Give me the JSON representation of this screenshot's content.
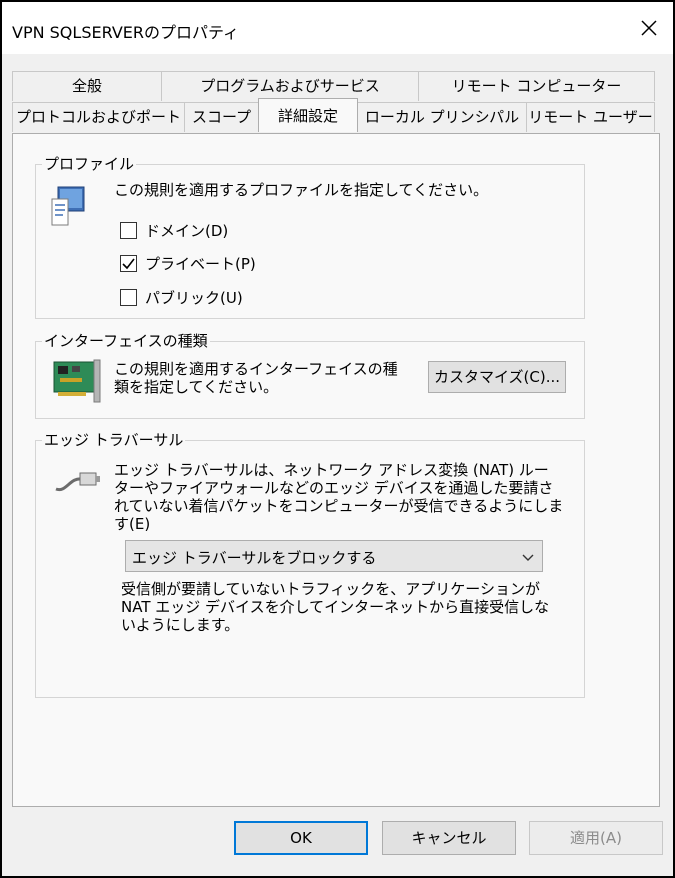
{
  "window": {
    "title": "VPN SQLSERVERのプロパティ"
  },
  "tabs": {
    "row1": [
      {
        "label": "全般"
      },
      {
        "label": "プログラムおよびサービス"
      },
      {
        "label": "リモート コンピューター"
      }
    ],
    "row2": [
      {
        "label": "プロトコルおよびポート"
      },
      {
        "label": "スコープ"
      },
      {
        "label": "詳細設定",
        "active": true
      },
      {
        "label": "ローカル プリンシパル"
      },
      {
        "label": "リモート ユーザー"
      }
    ]
  },
  "profile": {
    "group_label": "プロファイル",
    "description": "この規則を適用するプロファイルを指定してください。",
    "options": [
      {
        "label": "ドメイン(D)",
        "checked": false
      },
      {
        "label": "プライベート(P)",
        "checked": true
      },
      {
        "label": "パブリック(U)",
        "checked": false
      }
    ]
  },
  "interface": {
    "group_label": "インターフェイスの種類",
    "description_line1": "この規則を適用するインターフェイスの種",
    "description_line2": "類を指定してください。",
    "customize_label": "カスタマイズ(C)..."
  },
  "edge": {
    "group_label": "エッジ トラバーサル",
    "description_line1": "エッジ トラバーサルは、ネットワーク アドレス変換 (NAT) ルー",
    "description_line2": "ターやファイアウォールなどのエッジ デバイスを通過した要請さ",
    "description_line3": "れていない着信パケットをコンピューターが受信できるようにしま",
    "description_line4": "す(E)",
    "select_value": "エッジ トラバーサルをブロックする",
    "hint_line1": "受信側が要請していないトラフィックを、アプリケーションが",
    "hint_line2": "NAT エッジ デバイスを介してインターネットから直接受信しな",
    "hint_line3": "いようにします。"
  },
  "buttons": {
    "ok": "OK",
    "cancel": "キャンセル",
    "apply": "適用(A)"
  },
  "icons": {
    "close": "close-icon",
    "profile": "computer-icon",
    "interface": "network-card-icon",
    "edge": "cable-connector-icon",
    "dropdown": "chevron-down-icon",
    "check": "checkmark-icon"
  },
  "colors": {
    "dialog_bg": "#f0f0f0",
    "panel_bg": "#f9f9f9",
    "default_button_border": "#0078d7"
  }
}
